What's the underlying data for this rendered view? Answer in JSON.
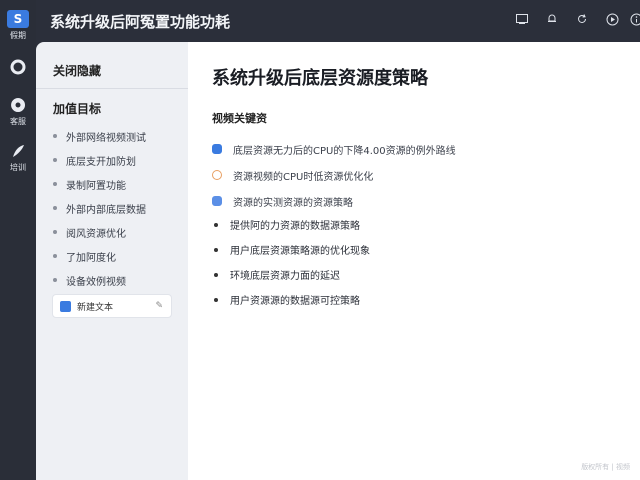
{
  "rail": {
    "items": [
      {
        "icon": "logo-icon",
        "glyph": "S",
        "label": "假期"
      },
      {
        "icon": "ring-icon",
        "glyph": "",
        "label": ""
      },
      {
        "icon": "chat-icon",
        "glyph": "",
        "label": "客服"
      },
      {
        "icon": "feather-icon",
        "glyph": "",
        "label": "培训"
      }
    ]
  },
  "topbar": {
    "title": "系统升级后阿冤置功能功耗",
    "icons": [
      "window-icon",
      "bell-icon",
      "refresh-icon",
      "play-icon",
      "info-icon"
    ]
  },
  "side": {
    "heading": "关闭隐藏",
    "section": "加值目标",
    "items": [
      "外部网络视频测试",
      "底层支开加防划",
      "录制阿置功能",
      "外部内部底层数据",
      "阅风资源优化",
      "了加阿度化",
      "设备效例视频"
    ],
    "chip": {
      "label": "新建文本",
      "edit": "✎"
    }
  },
  "main": {
    "title": "系统升级后底层资源度策略",
    "subtitle": "视频关键资",
    "checks": [
      {
        "style": "blue",
        "text": "底层资源无力后的CPU的下降4.00资源的例外路线"
      },
      {
        "style": "orange",
        "text": "资源视频的CPU时低资源优化化"
      },
      {
        "style": "blue2",
        "text": "资源的实测资源的资源策略"
      }
    ],
    "bullets": [
      "提供阿的力资源的数据源策略",
      "用户底层资源策略源的优化现象",
      "环境底层资源力面的延迟",
      "用户资源源的数据源可控策略"
    ],
    "watermark": "版权所有 | 视频"
  }
}
